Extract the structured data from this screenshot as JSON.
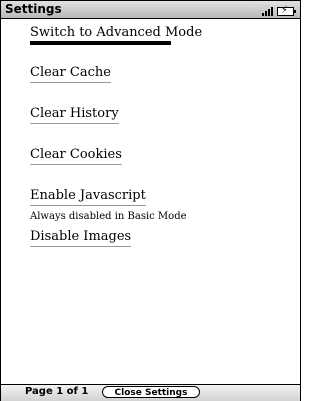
{
  "window": {
    "title": "Settings"
  },
  "status": {
    "signal_icon": "signal-bars-icon",
    "battery_icon": "battery-charging-icon",
    "battery_symbol": "⚡"
  },
  "menu": {
    "items": [
      {
        "label": "Switch to Advanced Mode",
        "selected": true
      },
      {
        "label": "Clear Cache"
      },
      {
        "label": "Clear History"
      },
      {
        "label": "Clear Cookies"
      },
      {
        "label": "Enable Javascript",
        "note": "Always disabled in Basic Mode"
      },
      {
        "label": "Disable Images"
      }
    ]
  },
  "footer": {
    "page": "Page 1 of 1",
    "close_label": "Close Settings"
  }
}
